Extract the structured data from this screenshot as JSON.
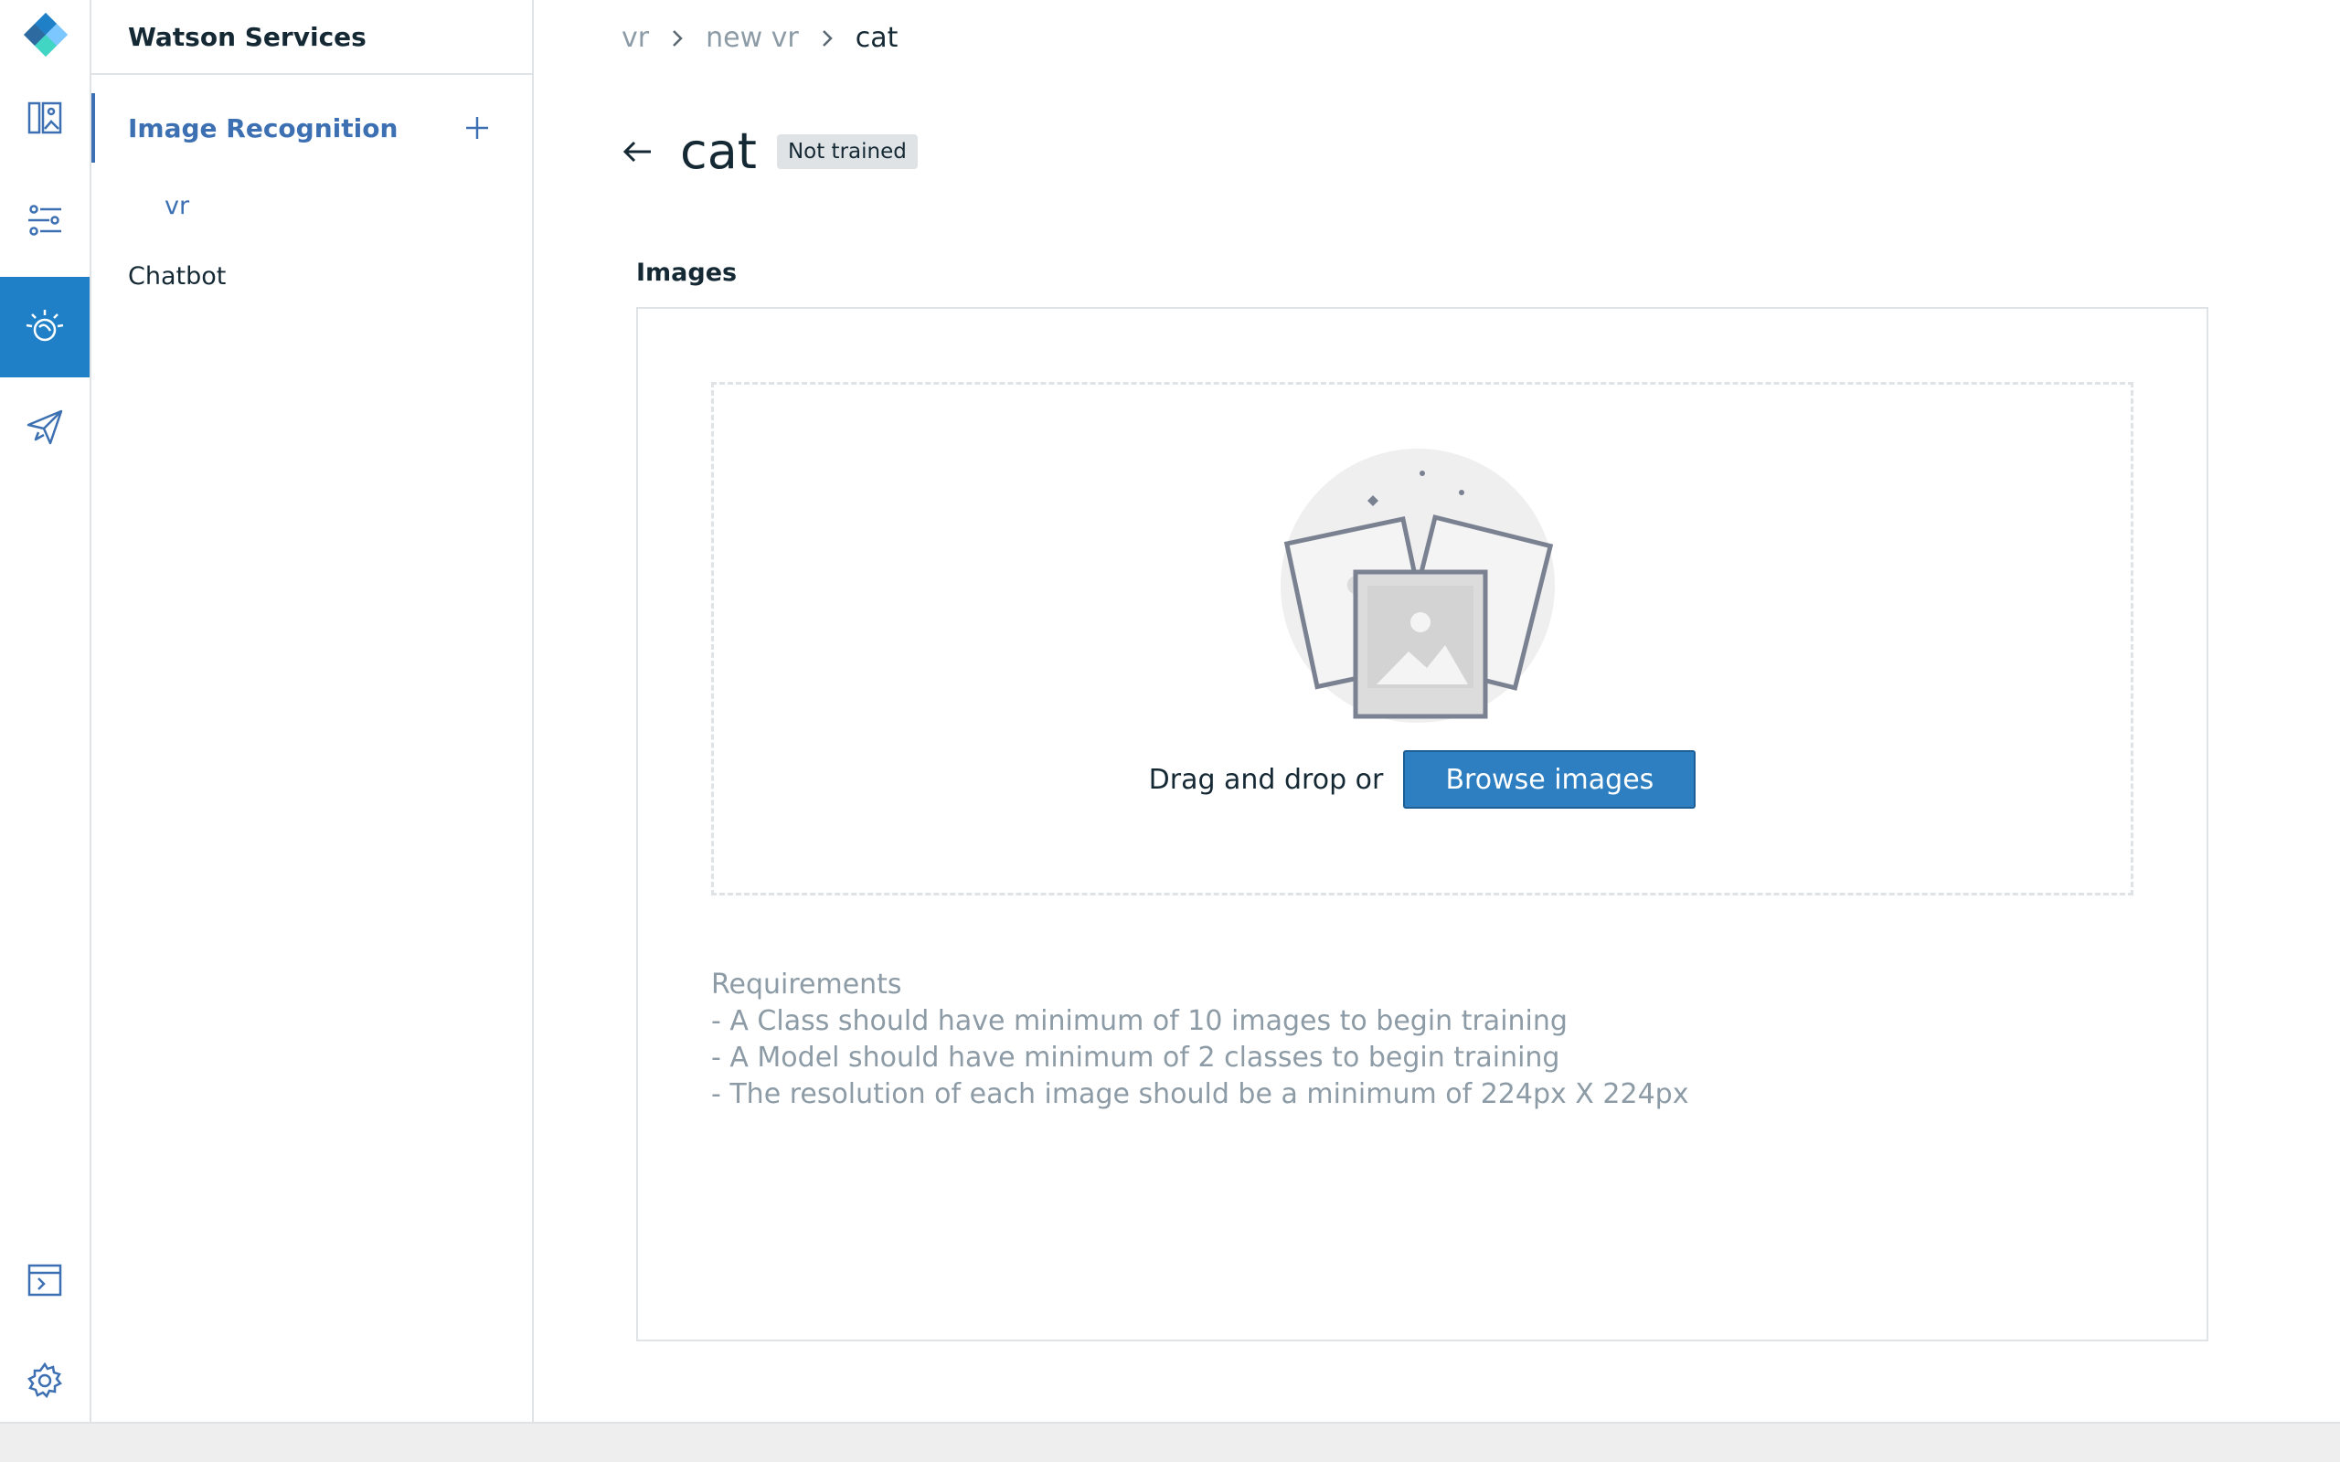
{
  "colors": {
    "accent": "#3d70b2",
    "rail_active": "#1f7fc7",
    "button": "#2d7fc1",
    "border": "#dfe3e6",
    "muted": "#8c9ba5"
  },
  "rail": {
    "icons": [
      "dashboard-icon",
      "sliders-icon",
      "watson-icon",
      "send-icon",
      "terminal-icon",
      "gear-icon"
    ],
    "active": "watson-icon"
  },
  "sidebar": {
    "header": "Watson Services",
    "section": {
      "label": "Image Recognition",
      "add_icon": "plus-icon"
    },
    "sub_items": [
      "vr"
    ],
    "items": [
      "Chatbot"
    ]
  },
  "breadcrumb": [
    "vr",
    "new vr",
    "cat"
  ],
  "page": {
    "title": "cat",
    "status_badge": "Not trained",
    "back_icon": "arrow-left-icon"
  },
  "images": {
    "label": "Images",
    "drop_text": "Drag and drop or",
    "browse_label": "Browse images",
    "requirements": [
      "Requirements",
      "- A Class should have minimum of 10 images to begin training",
      "- A Model should have minimum of 2 classes to begin training",
      "- The resolution of each image should be a minimum of 224px X 224px"
    ]
  }
}
